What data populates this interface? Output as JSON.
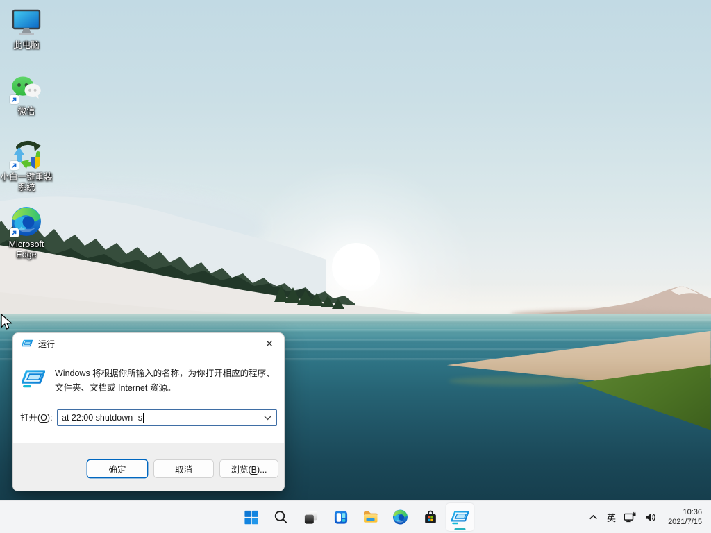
{
  "desktop": {
    "icons": {
      "this_pc": {
        "label": "此电脑"
      },
      "wechat": {
        "label": "微信"
      },
      "xiaobai": {
        "line1": "小白一键重装",
        "line2": "系统"
      },
      "edge": {
        "line1": "Microsoft",
        "line2": "Edge"
      }
    }
  },
  "run_dialog": {
    "title": "运行",
    "close_glyph": "✕",
    "description_line1": "Windows 将根据你所输入的名称，为你打开相应的程序、",
    "description_line2": "文件夹、文档或 Internet 资源。",
    "open_label_prefix": "打开(",
    "open_label_key": "O",
    "open_label_suffix": "):",
    "input_value": "at 22:00 shutdown -s",
    "ok_label": "确定",
    "cancel_label": "取消",
    "browse_label_prefix": "浏览(",
    "browse_label_key": "B",
    "browse_label_suffix": ")..."
  },
  "taskbar": {
    "apps": [
      "start",
      "search",
      "task-view",
      "widgets",
      "file-explorer",
      "edge",
      "store",
      "run"
    ],
    "active_app": "run"
  },
  "tray": {
    "ime": "英",
    "time": "10:36",
    "date": "2021/7/15"
  },
  "colors": {
    "accent": "#0067c0",
    "active_indicator": "#27b2bf",
    "taskbar_bg": "#f3f4f6"
  }
}
